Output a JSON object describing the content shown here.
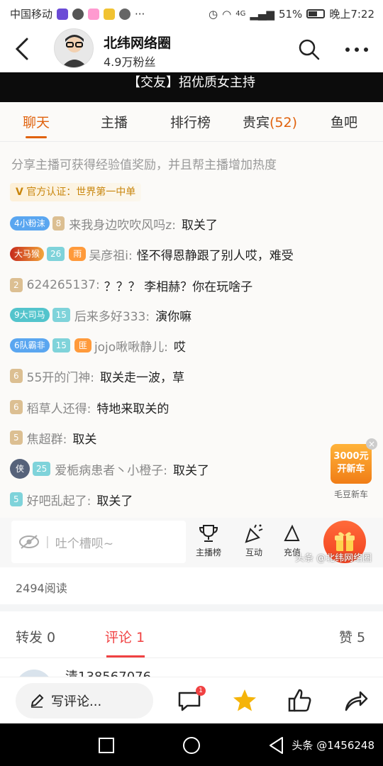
{
  "status_bar": {
    "carrier": "中国移动",
    "network": "4G",
    "battery": "51%",
    "time": "晚上7:22"
  },
  "header": {
    "author_name": "北纬网络圈",
    "followers": "4.9万粉丝"
  },
  "banner": {
    "text": "【交友】招优质女主持"
  },
  "live_tabs": [
    {
      "label": "聊天",
      "active": true
    },
    {
      "label": "主播",
      "active": false
    },
    {
      "label": "排行榜",
      "active": false
    },
    {
      "label": "贵宾",
      "count": "(52)",
      "active": false
    },
    {
      "label": "鱼吧",
      "active": false
    }
  ],
  "chat": {
    "notice": "分享主播可获得经验值奖励，并且帮主播增加热度",
    "verified": "官方认证：世界第一中单",
    "messages": [
      {
        "fan_badge": "4小粉沫",
        "level": "8",
        "user": "来我身边吹吹风吗z:",
        "text": "取关了"
      },
      {
        "fan_badge": "大马猴",
        "level": "26",
        "extra": "雨",
        "user": "吴彦祖i:",
        "text": "怪不得恩静跟了别人哎，难受"
      },
      {
        "level": "2",
        "user": "624265137:",
        "text": "？？？ 李相赫？你在玩啥子"
      },
      {
        "fan_badge": "9大司马",
        "level": "15",
        "user": "后来多好333:",
        "text": "演你嘛"
      },
      {
        "fan_badge": "6队霸非",
        "level": "15",
        "extra": "匪",
        "user": "jojo啾啾静儿:",
        "text": "哎"
      },
      {
        "level": "6",
        "user": "55开的门神:",
        "text": "取关走一波，草"
      },
      {
        "level": "6",
        "user": "稻草人还得:",
        "text": "特地来取关的"
      },
      {
        "level": "5",
        "user": "焦超群:",
        "text": "取关"
      },
      {
        "fan_badge": "侠",
        "level": "25",
        "user": "爱栀病患者丶小橙子:",
        "text": "取关了"
      },
      {
        "level": "5",
        "user": "好吧乱起了:",
        "text": "取关了"
      }
    ]
  },
  "ad": {
    "line1": "3000元",
    "line2": "开新车",
    "label": "毛豆新车"
  },
  "chat_input": {
    "placeholder": "吐个槽呗~"
  },
  "chat_actions": [
    {
      "label": "主播榜"
    },
    {
      "label": "互动"
    },
    {
      "label": "充值"
    }
  ],
  "watermark_overlay": "头条 @北纬网络圈",
  "reads": "2494阅读",
  "comment_tabs": {
    "repost": "转发 0",
    "comment": "评论 1",
    "like": "赞 5"
  },
  "comment_peek": {
    "name": "清138567076"
  },
  "action_bar": {
    "write_comment": "写评论...",
    "comment_badge": "1"
  },
  "nav_watermark": "头条 @1456248",
  "colors": {
    "accent_live": "#e0620d",
    "accent_comment": "#f04142",
    "chat_bg": "#fbfaf8"
  }
}
